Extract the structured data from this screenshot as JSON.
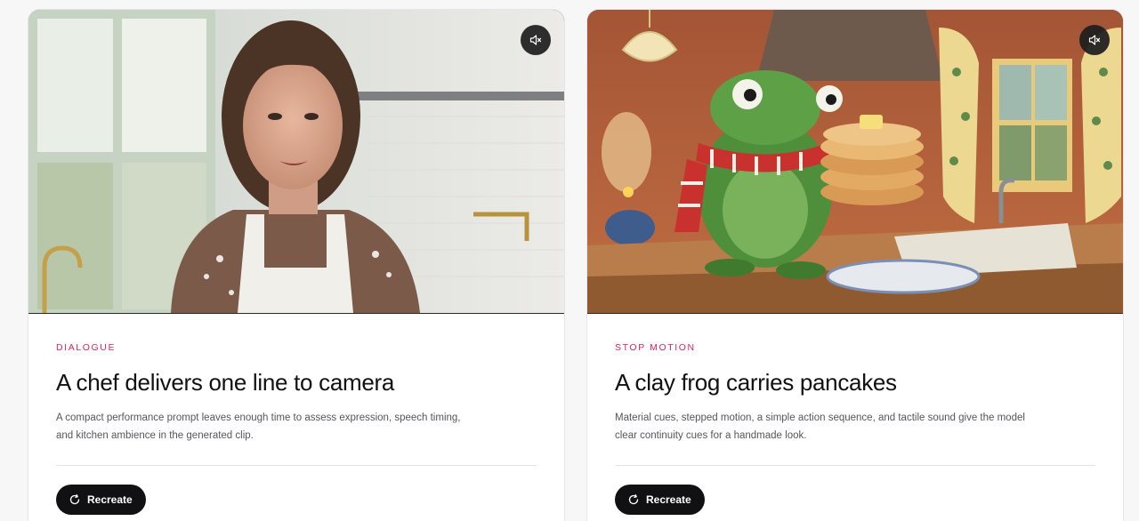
{
  "cards": [
    {
      "category": "DIALOGUE",
      "title": "A chef delivers one line to camera",
      "description": "A compact performance prompt leaves enough time to assess expression, speech timing, and kitchen ambience in the generated clip.",
      "button_label": "Recreate",
      "media_icon": "mute-icon"
    },
    {
      "category": "STOP MOTION",
      "title": "A clay frog carries pancakes",
      "description": "Material cues, stepped motion, a simple action sequence, and tactile sound give the model clear continuity cues for a handmade look.",
      "button_label": "Recreate",
      "media_icon": "mute-icon"
    }
  ],
  "colors": {
    "accent": "#e0245e",
    "button_bg": "#111114"
  }
}
